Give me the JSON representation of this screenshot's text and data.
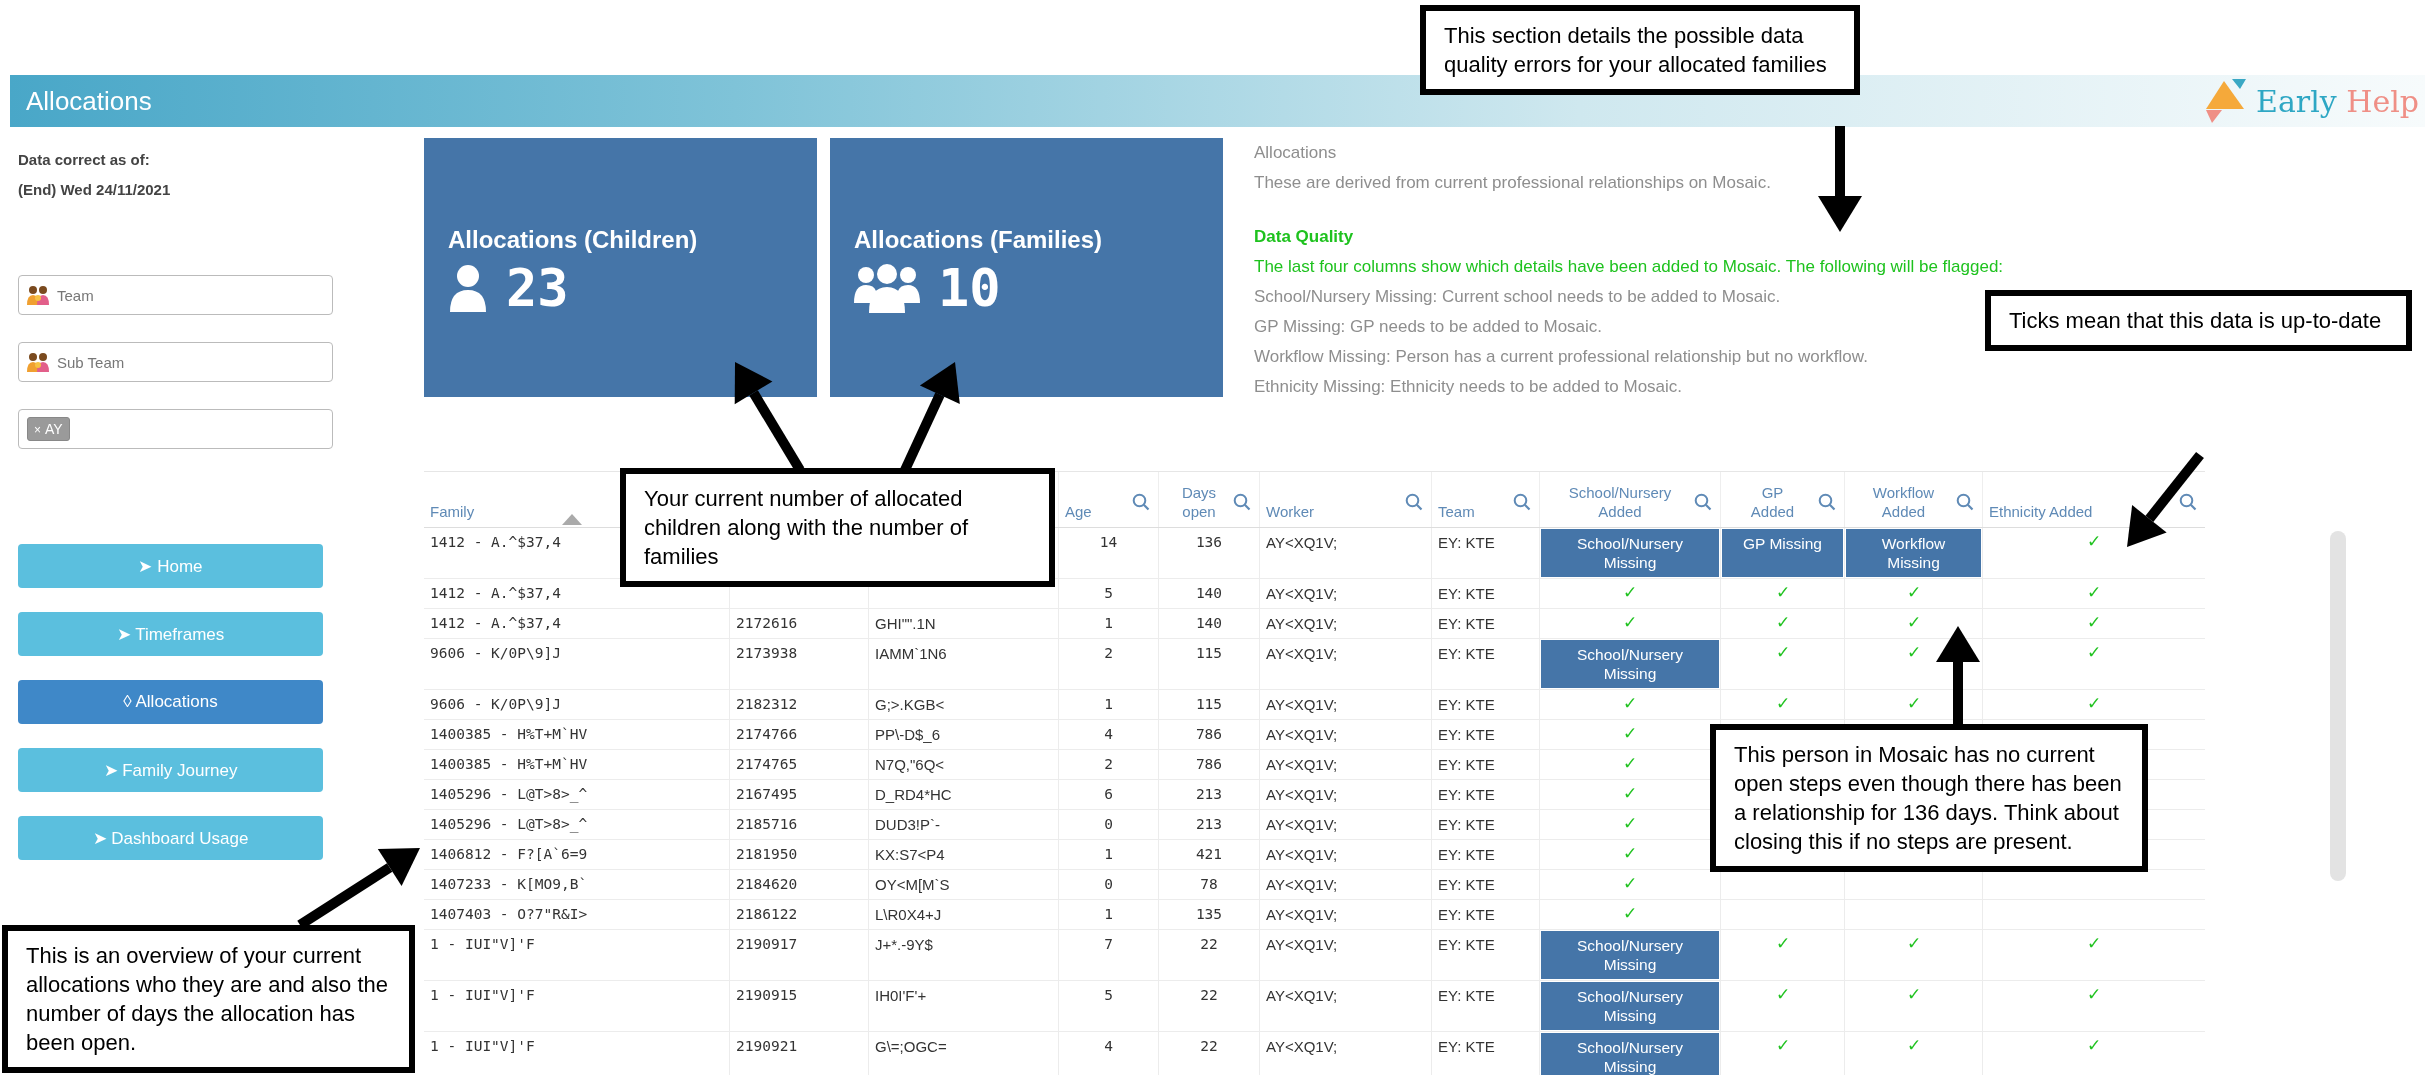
{
  "header": {
    "title": "Allocations",
    "logo": [
      "Early",
      "Help"
    ]
  },
  "sidebar": {
    "data_note": [
      "Data correct as of:",
      "(End) Wed 24/11/2021"
    ],
    "filters": [
      {
        "kind": "select",
        "placeholder": "Team"
      },
      {
        "kind": "select",
        "placeholder": "Sub Team"
      },
      {
        "kind": "chips",
        "chips": [
          {
            "remove": "×",
            "text": "AY"
          }
        ]
      }
    ],
    "nav": [
      {
        "label": "➤ Home",
        "selected": false
      },
      {
        "label": "➤ Timeframes",
        "selected": false
      },
      {
        "label": "◊ Allocations",
        "selected": true
      },
      {
        "label": "➤ Family Journey",
        "selected": false
      },
      {
        "label": "➤ Dashboard Usage",
        "selected": false
      }
    ]
  },
  "cards": [
    {
      "title": "Allocations (Children)",
      "value": "23"
    },
    {
      "title": "Allocations (Families)",
      "value": "10"
    }
  ],
  "info": {
    "title": "Allocations",
    "description": "These are derived from current professional relationships on Mosaic.",
    "heading": "Data Quality",
    "intro": "The last four columns show which details have been added to Mosaic. The following will be flagged:",
    "items": [
      "School/Nursery Missing: Current school needs to be added to Mosaic.",
      "GP Missing: GP needs to be added to Mosaic.",
      "Workflow Missing: Person has a current professional relationship but no workflow.",
      "Ethnicity Missing: Ethnicity needs to be added to Mosaic."
    ]
  },
  "table": {
    "columns": [
      {
        "label": "Family"
      },
      {},
      {},
      {
        "label": "Age"
      },
      {
        "label": "Days open"
      },
      {
        "label": "Worker"
      },
      {
        "label": "Team"
      },
      {
        "label": "School/Nursery Added"
      },
      {
        "label": "GP Added"
      },
      {
        "label": "Workflow Added"
      },
      {
        "label": "Ethnicity Added"
      }
    ],
    "rows": [
      {
        "family": "1412 - A.^$37,4",
        "age": "14",
        "days_open": "136",
        "worker": "AY<XQ1V;",
        "team": "EY: KTE",
        "school": {
          "added": false,
          "text": "School/Nursery Missing"
        },
        "gp": {
          "added": false,
          "text": "GP Missing"
        },
        "workflow": {
          "added": false,
          "text": "Workflow Missing"
        },
        "ethnicity": {
          "added": true,
          "text": "✓"
        }
      },
      {
        "family": "1412 - A.^$37,4",
        "age": "5",
        "days_open": "140",
        "worker": "AY<XQ1V;",
        "team": "EY: KTE",
        "school": {
          "added": true,
          "text": "✓"
        },
        "gp": {
          "added": true,
          "text": "✓"
        },
        "workflow": {
          "added": true,
          "text": "✓"
        },
        "ethnicity": {
          "added": true,
          "text": "✓"
        }
      },
      {
        "family": "1412 - A.^$37,4",
        "column_2": "2172616",
        "column_3": "GHI\"\".1N",
        "age": "1",
        "days_open": "140",
        "worker": "AY<XQ1V;",
        "team": "EY: KTE",
        "school": {
          "added": true,
          "text": "✓"
        },
        "gp": {
          "added": true,
          "text": "✓"
        },
        "workflow": {
          "added": true,
          "text": "✓"
        },
        "ethnicity": {
          "added": true,
          "text": "✓"
        }
      },
      {
        "family": "9606 - K/0P\\9]J",
        "column_2": "2173938",
        "column_3": "IAMM`1N6",
        "age": "2",
        "days_open": "115",
        "worker": "AY<XQ1V;",
        "team": "EY: KTE",
        "school": {
          "added": false,
          "text": "School/Nursery Missing"
        },
        "gp": {
          "added": true,
          "text": "✓"
        },
        "workflow": {
          "added": true,
          "text": "✓"
        },
        "ethnicity": {
          "added": true,
          "text": "✓"
        }
      },
      {
        "family": "9606 - K/0P\\9]J",
        "column_2": "2182312",
        "column_3": "G;>.KGB<",
        "age": "1",
        "days_open": "115",
        "worker": "AY<XQ1V;",
        "team": "EY: KTE",
        "school": {
          "added": true,
          "text": "✓"
        },
        "gp": {
          "added": true,
          "text": "✓"
        },
        "workflow": {
          "added": true,
          "text": "✓"
        },
        "ethnicity": {
          "added": true,
          "text": "✓"
        }
      },
      {
        "family": "1400385 - H%T+M`HV",
        "column_2": "2174766",
        "column_3": "PP\\-D$_6",
        "age": "4",
        "days_open": "786",
        "worker": "AY<XQ1V;",
        "team": "EY: KTE",
        "school": {
          "added": true,
          "text": "✓"
        }
      },
      {
        "family": "1400385 - H%T+M`HV",
        "column_2": "2174765",
        "column_3": "N7Q,\"6Q<",
        "age": "2",
        "days_open": "786",
        "worker": "AY<XQ1V;",
        "team": "EY: KTE",
        "school": {
          "added": true,
          "text": "✓"
        }
      },
      {
        "family": "1405296 - L@T>8>_^",
        "column_2": "2167495",
        "column_3": "D_RD4*HC",
        "age": "6",
        "days_open": "213",
        "worker": "AY<XQ1V;",
        "team": "EY: KTE",
        "school": {
          "added": true,
          "text": "✓"
        }
      },
      {
        "family": "1405296 - L@T>8>_^",
        "column_2": "2185716",
        "column_3": "DUD3!P`-",
        "age": "0",
        "days_open": "213",
        "worker": "AY<XQ1V;",
        "team": "EY: KTE",
        "school": {
          "added": true,
          "text": "✓"
        }
      },
      {
        "family": "1406812 - F?[A`6=9",
        "column_2": "2181950",
        "column_3": "KX:S7<P4",
        "age": "1",
        "days_open": "421",
        "worker": "AY<XQ1V;",
        "team": "EY: KTE",
        "school": {
          "added": true,
          "text": "✓"
        }
      },
      {
        "family": "1407233 - K[MO9,B`",
        "column_2": "2184620",
        "column_3": "OY<M[M`S",
        "age": "0",
        "days_open": "78",
        "worker": "AY<XQ1V;",
        "team": "EY: KTE",
        "school": {
          "added": true,
          "text": "✓"
        }
      },
      {
        "family": "1407403 - O?7\"R&I>",
        "column_2": "2186122",
        "column_3": "L\\R0X4+J",
        "age": "1",
        "days_open": "135",
        "worker": "AY<XQ1V;",
        "team": "EY: KTE",
        "school": {
          "added": true,
          "text": "✓"
        }
      },
      {
        "family": "1 - IUI\"V]'F",
        "column_2": "2190917",
        "column_3": "J+*.-9Y$",
        "age": "7",
        "days_open": "22",
        "worker": "AY<XQ1V;",
        "team": "EY: KTE",
        "school": {
          "added": false,
          "text": "School/Nursery Missing"
        },
        "gp": {
          "added": true,
          "text": "✓"
        },
        "workflow": {
          "added": true,
          "text": "✓"
        },
        "ethnicity": {
          "added": true,
          "text": "✓"
        }
      },
      {
        "family": "1 - IUI\"V]'F",
        "column_2": "2190915",
        "column_3": "IH0I'F'+",
        "age": "5",
        "days_open": "22",
        "worker": "AY<XQ1V;",
        "team": "EY: KTE",
        "school": {
          "added": false,
          "text": "School/Nursery Missing"
        },
        "gp": {
          "added": true,
          "text": "✓"
        },
        "workflow": {
          "added": true,
          "text": "✓"
        },
        "ethnicity": {
          "added": true,
          "text": "✓"
        }
      },
      {
        "family": "1 - IUI\"V]'F",
        "column_2": "2190921",
        "column_3": "G\\=;OGC=",
        "age": "4",
        "days_open": "22",
        "worker": "AY<XQ1V;",
        "team": "EY: KTE",
        "school": {
          "added": false,
          "text": "School/Nursery Missing"
        },
        "gp": {
          "added": true,
          "text": "✓"
        },
        "workflow": {
          "added": true,
          "text": "✓"
        },
        "ethnicity": {
          "added": true,
          "text": "✓"
        }
      }
    ]
  },
  "annotations": [
    "This section details the possible data quality errors for your allocated families",
    "Your current number of allocated children along with the number of families",
    "Ticks mean that this data is up-to-date",
    "This person in Mosaic has no current open steps even though there has been a relationship for 136 days. Think about closing this if no steps are present.",
    "This is an overview of your current allocations who they are and also the number of days the allocation has been open."
  ]
}
